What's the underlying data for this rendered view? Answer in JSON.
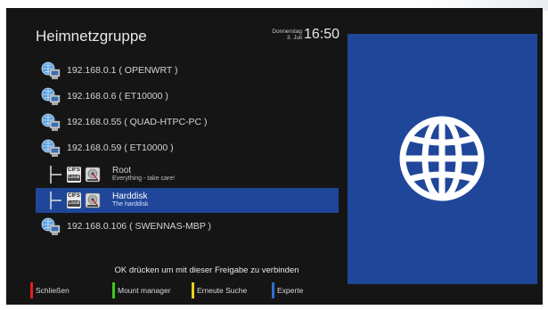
{
  "header": {
    "title": "Heimnetzgruppe",
    "date_day": "Donnerstag",
    "date_date": "3. Juli",
    "time": "16:50"
  },
  "hosts": [
    {
      "label": "192.168.0.1 ( OPENWRT )"
    },
    {
      "label": "192.168.0.6 ( ET10000 )"
    },
    {
      "label": "192.168.0.55 ( QUAD-HTPC-PC )"
    },
    {
      "label": "192.168.0.59 ( ET10000 )"
    }
  ],
  "shares": [
    {
      "name": "Root",
      "description": "Everything - take care!",
      "type_label": "CIFS",
      "type_sub": "Local",
      "selected": false
    },
    {
      "name": "Harddisk",
      "description": "The harddisk",
      "type_label": "CIFS",
      "type_sub": "Local",
      "selected": true
    }
  ],
  "last_host": {
    "label": "192.168.0.106 ( SWENNAS-MBP )"
  },
  "hint": "OK drücken um mit dieser Freigabe zu verbinden",
  "buttons": {
    "red": {
      "label": "Schließen",
      "color": "#e02020"
    },
    "green": {
      "label": "Mount manager",
      "color": "#3ec820"
    },
    "yellow": {
      "label": "Erneute Suche",
      "color": "#e8d020"
    },
    "blue": {
      "label": "Experte",
      "color": "#2a6fd8"
    }
  },
  "panel": {
    "icon": "globe-icon",
    "color": "#1f4698"
  }
}
